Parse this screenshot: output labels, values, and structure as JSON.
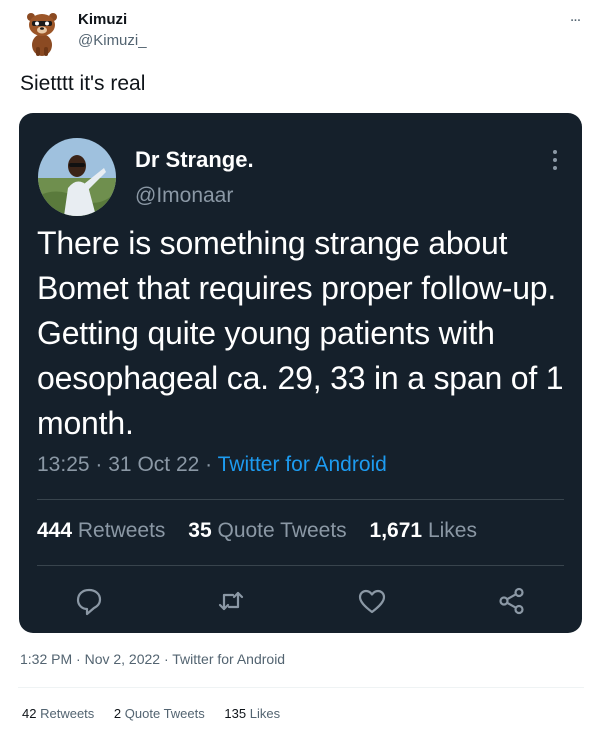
{
  "outer_tweet": {
    "author_name": "Kimuzi",
    "author_handle": "@Kimuzi_",
    "more_icon": "...",
    "text": "Sietttt it's real",
    "timestamp": "1:32 PM · Nov 2, 2022 · Twitter for Android",
    "stats": {
      "retweets_count": "42",
      "retweets_label": "Retweets",
      "quotes_count": "2",
      "quotes_label": "Quote Tweets",
      "likes_count": "135",
      "likes_label": "Likes"
    }
  },
  "quoted_tweet": {
    "author_name": "Dr Strange.",
    "author_handle": "@Imonaar",
    "text": "There is something strange about Bomet that requires proper follow-up. Getting quite young patients with oesophageal ca. 29, 33 in a span of 1 month.",
    "time": "13:25",
    "separator": "·",
    "date": "31 Oct 22",
    "source": "Twitter for Android",
    "stats": {
      "retweets_count": "444",
      "retweets_label": "Retweets",
      "quotes_count": "35",
      "quotes_label": "Quote Tweets",
      "likes_count": "1,671",
      "likes_label": "Likes"
    },
    "actions": [
      "reply-icon",
      "retweet-icon",
      "like-icon",
      "share-icon"
    ]
  },
  "colors": {
    "card_bg": "#15202b",
    "link_blue": "#1d9bf0",
    "muted_dark": "#8b98a5",
    "muted_light": "#536471"
  }
}
